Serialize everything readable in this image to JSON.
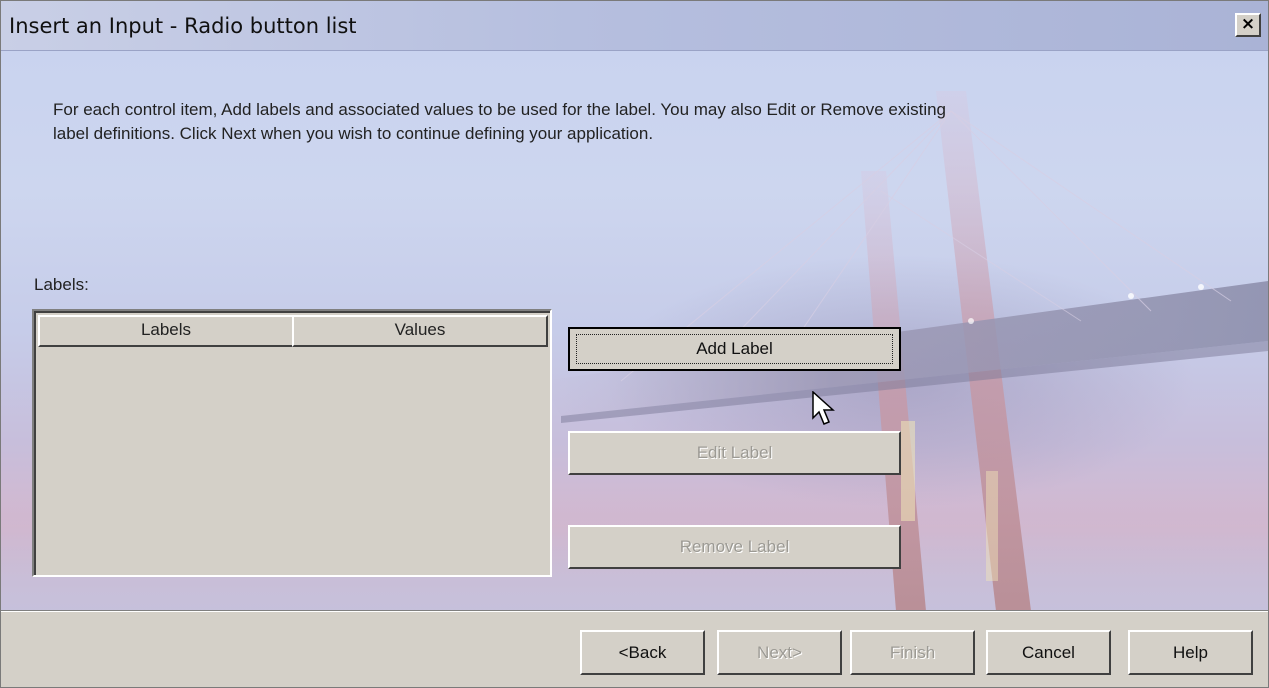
{
  "window": {
    "title": "Insert an Input - Radio button list",
    "close_label": "×"
  },
  "instructions": {
    "line1": "For each control item, Add labels and associated values to be used for the label. You may also Edit or Remove existing",
    "line2": "label definitions. Click Next when you wish to continue defining your application."
  },
  "labels_section": {
    "caption": "Labels:",
    "columns": [
      "Labels",
      "Values"
    ],
    "rows": []
  },
  "side_buttons": {
    "add": "Add Label",
    "edit": "Edit Label",
    "remove": "Remove Label"
  },
  "footer_buttons": {
    "back": "<Back",
    "next": "Next>",
    "finish": "Finish",
    "cancel": "Cancel",
    "help": "Help"
  },
  "colors": {
    "dialog_face": "#d4d0c8",
    "disabled_text": "#9c9a94"
  },
  "icons": {
    "close": "close-icon",
    "cursor": "mouse-pointer-icon"
  }
}
